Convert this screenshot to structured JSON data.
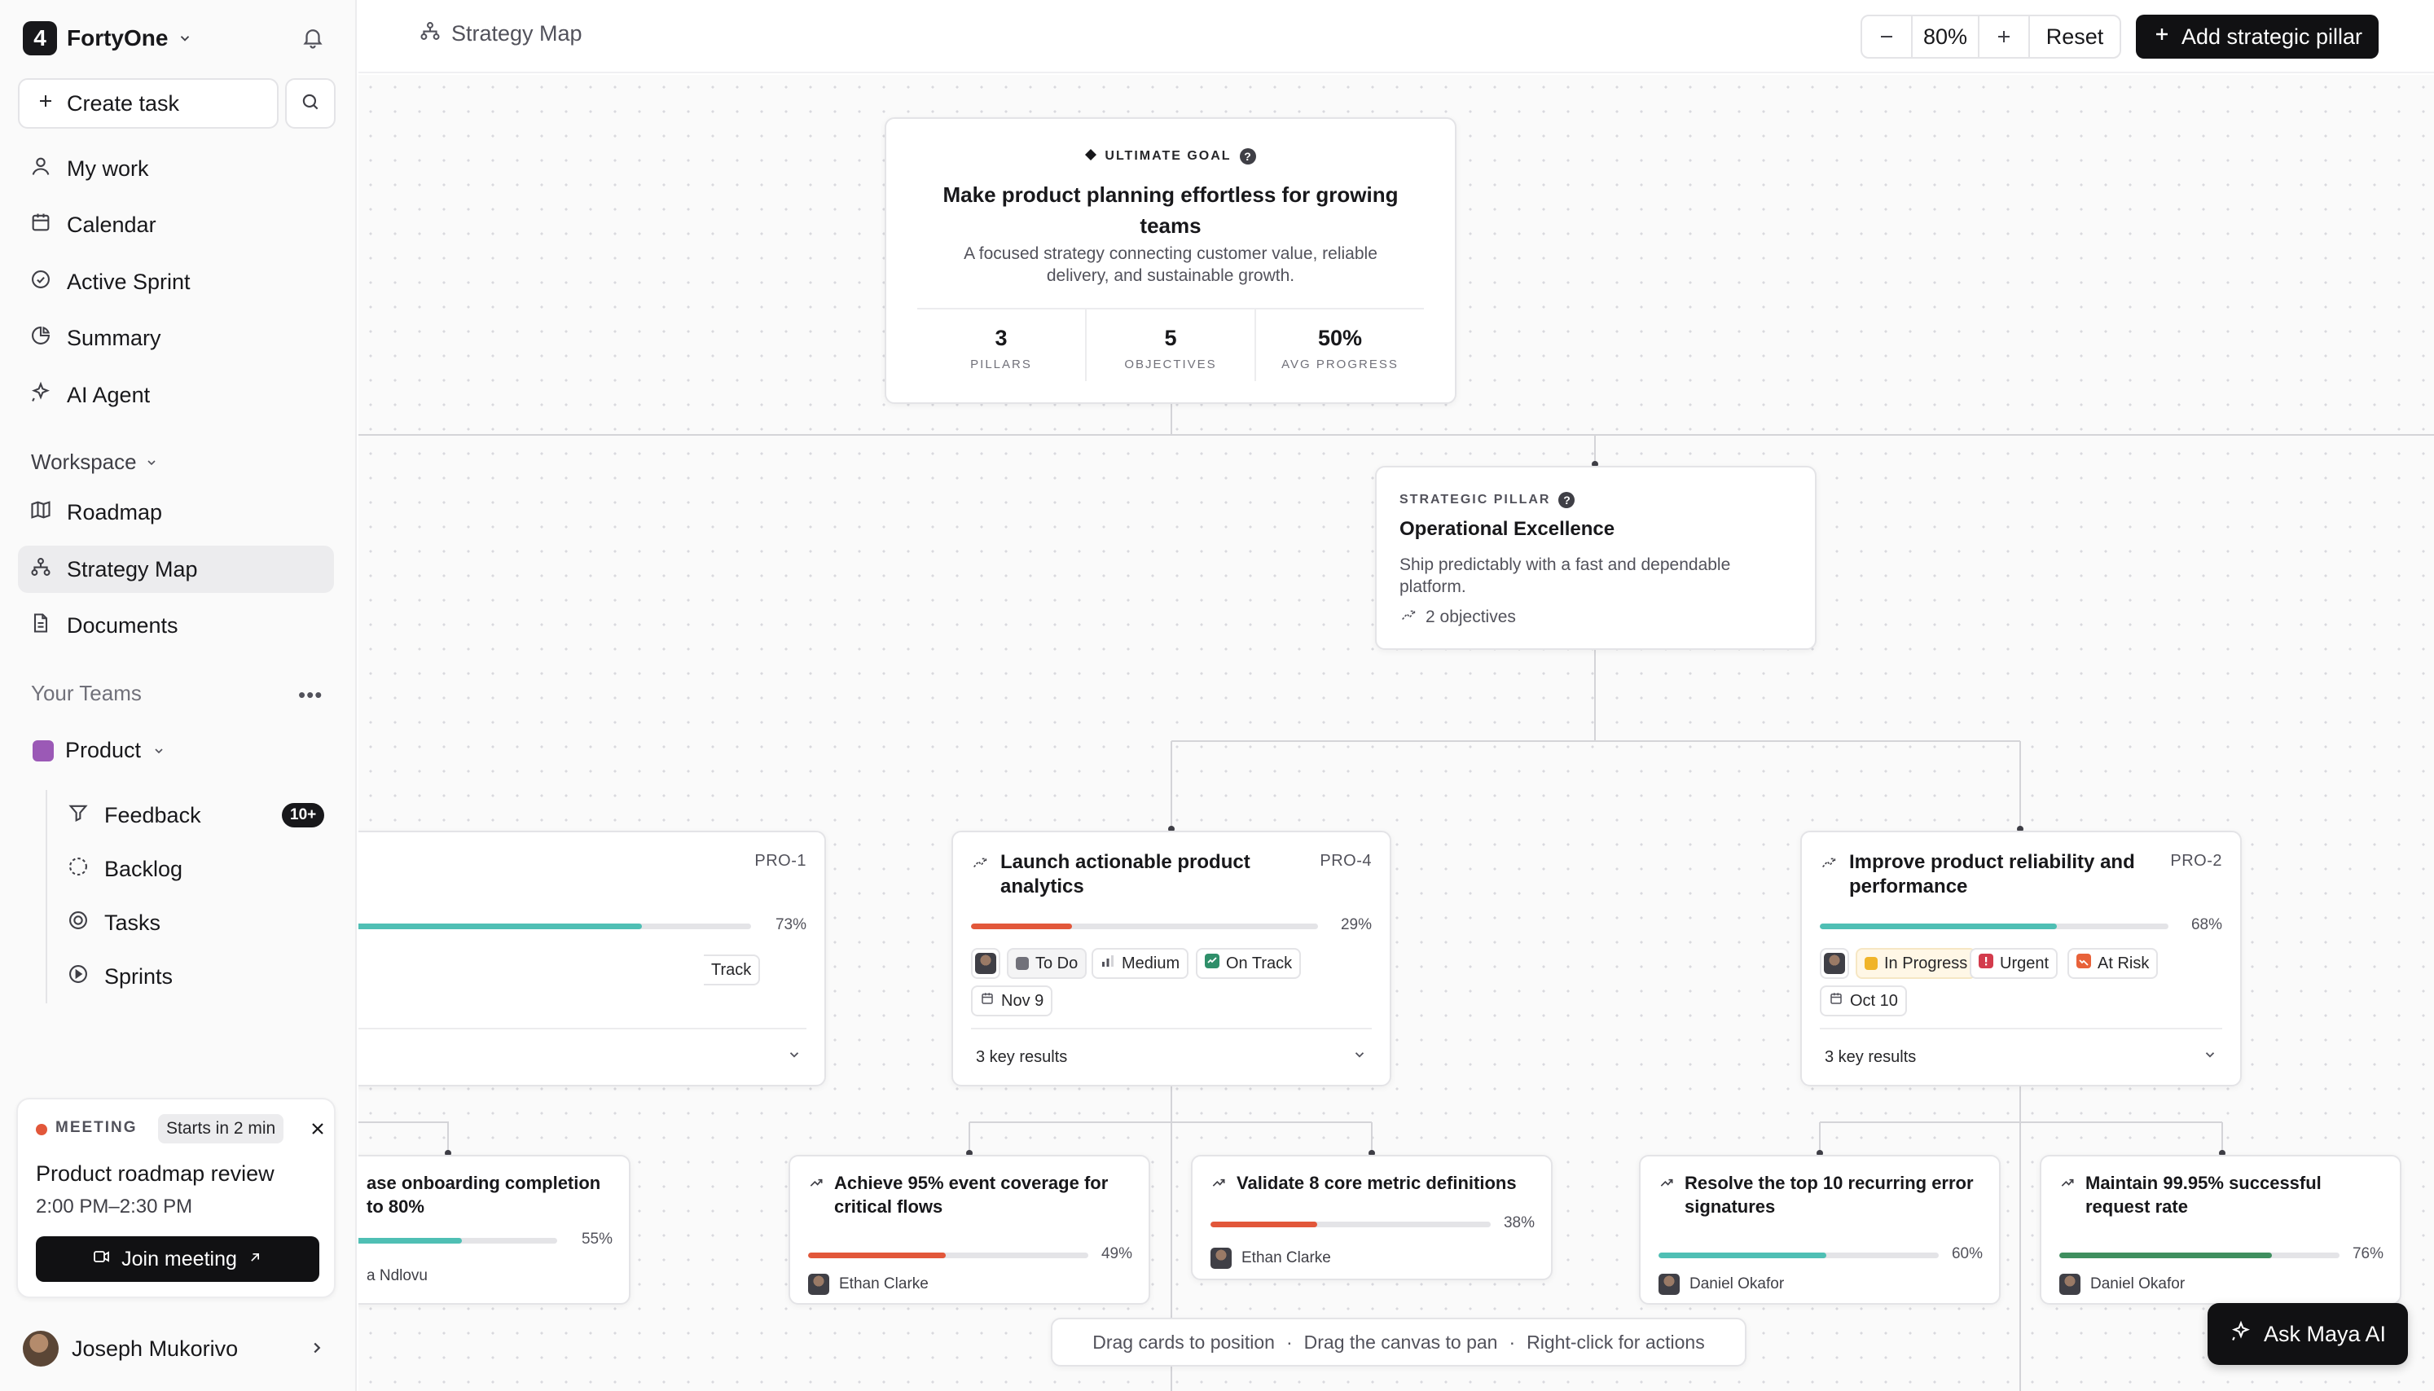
{
  "app": {
    "name": "FortyOne"
  },
  "sidebar": {
    "create_task": "Create task",
    "nav": [
      {
        "label": "My work",
        "icon": "user-icon"
      },
      {
        "label": "Calendar",
        "icon": "calendar-icon"
      },
      {
        "label": "Active Sprint",
        "icon": "check-circle-icon"
      },
      {
        "label": "Summary",
        "icon": "pie-chart-icon"
      },
      {
        "label": "AI Agent",
        "icon": "sparkle-icon"
      }
    ],
    "workspace_label": "Workspace",
    "workspace_nav": [
      {
        "label": "Roadmap",
        "icon": "map-icon"
      },
      {
        "label": "Strategy Map",
        "icon": "hierarchy-icon",
        "active": true
      },
      {
        "label": "Documents",
        "icon": "document-icon"
      }
    ],
    "teams_label": "Your Teams",
    "teams_more": "•••",
    "team": {
      "name": "Product",
      "color": "#9b59b6"
    },
    "team_nav": [
      {
        "label": "Feedback",
        "icon": "funnel-icon",
        "badge": "10+"
      },
      {
        "label": "Backlog",
        "icon": "dashed-circle-icon"
      },
      {
        "label": "Tasks",
        "icon": "target-icon"
      },
      {
        "label": "Sprints",
        "icon": "play-circle-icon"
      }
    ],
    "meeting": {
      "label": "MEETING",
      "starts": "Starts in 2 min",
      "title": "Product roadmap review",
      "time": "2:00 PM–2:30 PM",
      "join": "Join meeting"
    },
    "user": {
      "name": "Joseph Mukorivo"
    }
  },
  "topbar": {
    "breadcrumb": "Strategy Map",
    "zoom": "80%",
    "reset": "Reset",
    "add_pillar": "Add strategic pillar"
  },
  "goal": {
    "kicker": "ULTIMATE GOAL",
    "title": "Make product planning effortless for growing teams",
    "description": "A focused strategy connecting customer value, reliable delivery, and sustainable growth.",
    "stats": [
      {
        "value": "3",
        "label": "PILLARS"
      },
      {
        "value": "5",
        "label": "OBJECTIVES"
      },
      {
        "value": "50%",
        "label": "AVG PROGRESS"
      }
    ]
  },
  "pillar": {
    "kicker": "STRATEGIC PILLAR",
    "title": "Operational Excellence",
    "description": "Ship predictably with a fast and dependable platform.",
    "objectives": "2 objectives"
  },
  "objectives": [
    {
      "id": "PRO-1",
      "progress_label": "73%",
      "chip_partial": "Track",
      "progress": 0.73
    },
    {
      "title": "Launch actionable product analytics",
      "id": "PRO-4",
      "progress": 0.29,
      "progress_label": "29%",
      "color": "#e2573a",
      "status": "To Do",
      "priority": "Medium",
      "health": "On Track",
      "date": "Nov 9",
      "key_results": "3 key results"
    },
    {
      "title": "Improve product reliability and performance",
      "id": "PRO-2",
      "progress": 0.68,
      "progress_label": "68%",
      "color": "#4fbfb4",
      "status": "In Progress",
      "priority": "Urgent",
      "health": "At Risk",
      "date": "Oct 10",
      "key_results": "3 key results"
    }
  ],
  "key_results": [
    {
      "title": "ase onboarding completion to 80%",
      "progress": 0.55,
      "progress_label": "55%",
      "owner": "a Ndlovu",
      "color": "#4fbfb4"
    },
    {
      "title": "Achieve 95% event coverage for critical flows",
      "progress": 0.49,
      "progress_label": "49%",
      "owner": "Ethan Clarke",
      "color": "#e2573a"
    },
    {
      "title": "Validate 8 core metric definitions",
      "progress": 0.38,
      "progress_label": "38%",
      "owner": "Ethan Clarke",
      "color": "#e2573a"
    },
    {
      "title": "Resolve the top 10 recurring error signatures",
      "progress": 0.6,
      "progress_label": "60%",
      "owner": "Daniel Okafor",
      "color": "#4fbfb4"
    },
    {
      "title": "Maintain 99.95% successful request rate",
      "progress": 0.76,
      "progress_label": "76%",
      "owner": "Daniel Okafor",
      "color": "#3f8f5f"
    }
  ],
  "hints": [
    "Drag cards to position",
    "·",
    "Drag the canvas to pan",
    "·",
    "Right-click for actions"
  ],
  "ask_ai": "Ask Maya AI"
}
